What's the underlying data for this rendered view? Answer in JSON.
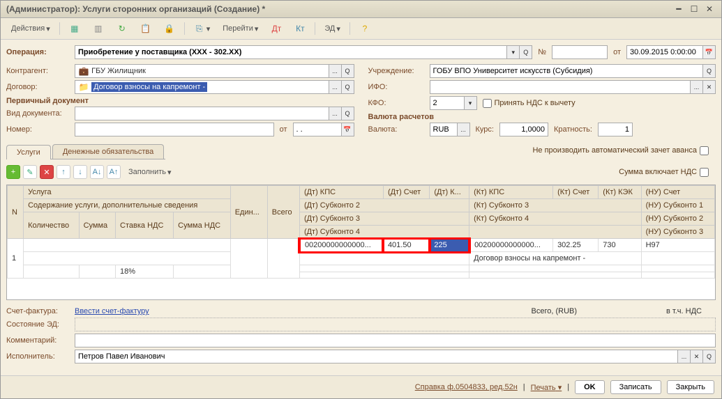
{
  "window": {
    "title": "(Администратор): Услуги сторонних организаций (Создание) *"
  },
  "toolbar": {
    "actions": "Действия",
    "goto": "Перейти",
    "ed": "ЭД"
  },
  "form": {
    "operation_label": "Операция:",
    "operation_value": "Приобретение у поставщика (XXX - 302.XX)",
    "number_label": "№",
    "date_label": "от",
    "date_value": "30.09.2015 0:00:00",
    "counterparty_label": "Контрагент:",
    "counterparty_value": "ГБУ Жилищник",
    "institution_label": "Учреждение:",
    "institution_value": "ГОБУ ВПО Университет искусств (Субсидия)",
    "contract_label": "Договор:",
    "contract_value": "Договор  взносы на капремонт -",
    "ifo_label": "ИФО:",
    "kfo_label": "КФО:",
    "kfo_value": "2",
    "vat_checkbox": "Принять НДС к вычету",
    "section_primary": "Первичный документ",
    "doc_type_label": "Вид документа:",
    "number2_label": "Номер:",
    "from_label": "от",
    "section_currency": "Валюта расчетов",
    "currency_label": "Валюта:",
    "currency_value": "RUB",
    "rate_label": "Курс:",
    "rate_value": "1,0000",
    "multiplicity_label": "Кратность:",
    "multiplicity_value": "1"
  },
  "tabs": {
    "services": "Услуги",
    "obligations": "Денежные обязательства"
  },
  "grid_options": {
    "fill": "Заполнить",
    "no_auto_offset": "Не производить автоматический зачет аванса",
    "sum_includes_vat": "Сумма включает НДС"
  },
  "grid": {
    "headers": {
      "n": "N",
      "service": "Услуга",
      "unit": "Един...",
      "total": "Всего",
      "dt_kps": "(Дт) КПС",
      "dt_acc": "(Дт) Счет",
      "dt_k": "(Дт) К...",
      "kt_kps": "(Кт) КПС",
      "kt_acc": "(Кт) Счет",
      "kt_kek": "(Кт) КЭК",
      "nu_acc": "(НУ) Счет",
      "desc": "Содержание услуги, дополнительные сведения",
      "dt_sub2": "(Дт) Субконто 2",
      "kt_sub3": "(Кт) Субконто 3",
      "nu_sub1": "(НУ) Субконто 1",
      "qty": "Количество",
      "sum": "Сумма",
      "vat_rate": "Ставка НДС",
      "vat_sum": "Сумма НДС",
      "dt_sub3": "(Дт) Субконто 3",
      "kt_sub4": "(Кт) Субконто 4",
      "nu_sub2": "(НУ) Субконто 2",
      "dt_sub4": "(Дт) Субконто 4",
      "nu_sub3": "(НУ) Субконто 3"
    },
    "row": {
      "n": "1",
      "dt_kps": "00200000000000...",
      "dt_acc": "401.50",
      "dt_k": "225",
      "kt_kps": "00200000000000...",
      "kt_acc": "302.25",
      "kt_kek": "730",
      "nu_acc": "Н97",
      "kt_sub3": "Договор  взносы на капремонт -",
      "vat_rate": "18%"
    }
  },
  "bottom": {
    "invoice_label": "Счет-фактура:",
    "invoice_link": "Ввести счет-фактуру",
    "total_label": "Всего, (RUB)",
    "vat_label": "в т.ч. НДС",
    "ed_state_label": "Состояние ЭД:",
    "comment_label": "Комментарий:",
    "performer_label": "Исполнитель:",
    "performer_value": "Петров Павел Иванович"
  },
  "statusbar": {
    "reference": "Справка ф.0504833, ред.52н",
    "print": "Печать",
    "ok": "OK",
    "save": "Записать",
    "close": "Закрыть"
  }
}
